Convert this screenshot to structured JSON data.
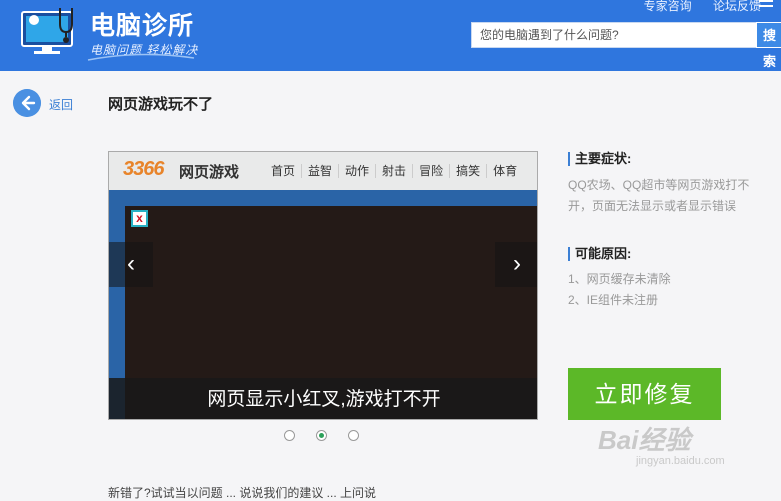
{
  "header": {
    "brand_title": "电脑诊所",
    "brand_subtitle": "电脑问题 轻松解决",
    "links": [
      "专家咨询",
      "论坛反馈"
    ],
    "search_placeholder": "您的电脑遇到了什么问题?",
    "search_button": "搜索"
  },
  "nav": {
    "back_label": "返回"
  },
  "page": {
    "title": "网页游戏玩不了"
  },
  "slideshow": {
    "game_logo": "3366",
    "game_name": "网页游戏",
    "game_nav": [
      "首页",
      "益智",
      "动作",
      "射击",
      "冒险",
      "搞笑",
      "体育"
    ],
    "broken_image_mark": "x",
    "caption": "网页显示小红叉,游戏打不开",
    "slide_count": 3,
    "active_slide": 2,
    "prev_arrow": "‹",
    "next_arrow": "›"
  },
  "symptoms": {
    "heading": "主要症状:",
    "text": "QQ农场、QQ超市等网页游戏打不开，页面无法显示或者显示错误"
  },
  "causes": {
    "heading": "可能原因:",
    "items": [
      "1、网页缓存未清除",
      "2、IE组件未注册"
    ]
  },
  "actions": {
    "fix_button": "立即修复"
  },
  "watermark": {
    "brand": "Bai经验",
    "url": "jingyan.baidu.com"
  },
  "footer": {
    "partial_text": "新错了?试试当以问题 ... 说说我们的建议 ... 上问说"
  },
  "colors": {
    "header_bg": "#2f76de",
    "fix_button_bg": "#5cb828",
    "accent_blue": "#3b7fd4"
  }
}
